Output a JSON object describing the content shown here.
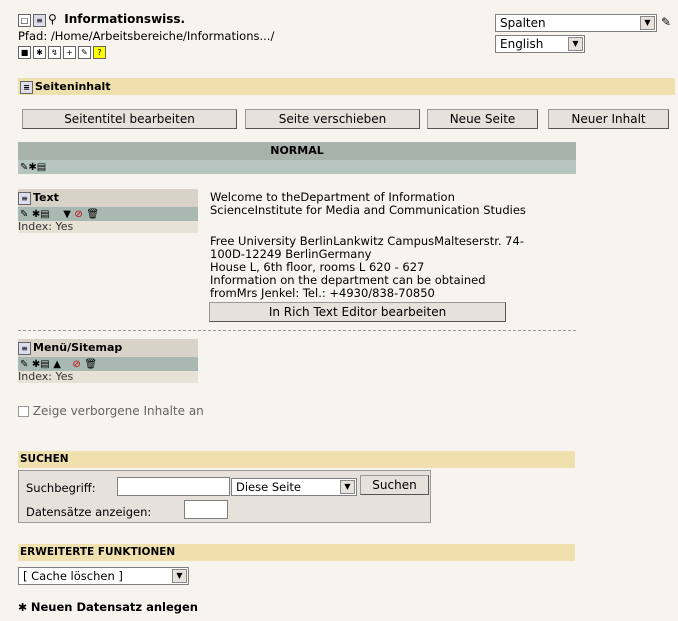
{
  "header": {
    "title": "Informationswiss.",
    "path": "Pfad: /Home/Arbeitsbereiche/Informations.../",
    "view_select": "Spalten",
    "lang_select": "English"
  },
  "content_section": {
    "title": "Seiteninhalt",
    "buttons": [
      "Seitentitel bearbeiten",
      "Seite verschieben",
      "Neue Seite",
      "Neuer Inhalt"
    ],
    "column_title": "NORMAL"
  },
  "elements": {
    "text": {
      "title": "Text",
      "index": "Index: Yes",
      "lines": [
        "Welcome to theDepartment of Information",
        "ScienceInstitute for Media and Communication Studies",
        "Free University BerlinLankwitz CampusMalteserstr. 74-",
        "100D-12249 BerlinGermany",
        "House L, 6th floor, rooms L 620 - 627",
        "Information on the department can be obtained",
        "fromMrs Jenkel: Tel.: +4930/838-70850"
      ],
      "rte_button": "In Rich Text Editor bearbeiten"
    },
    "menu": {
      "title": "Menü/Sitemap",
      "index": "Index: Yes"
    }
  },
  "hidden_toggle": "Zeige verborgene Inhalte an",
  "search": {
    "title": "SUCHEN",
    "term_label": "Suchbegriff:",
    "term_value": "",
    "scope_select": "Diese Seite",
    "submit": "Suchen",
    "records_label": "Datensätze anzeigen:",
    "records_value": ""
  },
  "advanced": {
    "title": "ERWEITERTE FUNKTIONEN",
    "cache_select": "[ Cache löschen ]",
    "new_record": "Neuen Datensatz anlegen"
  }
}
